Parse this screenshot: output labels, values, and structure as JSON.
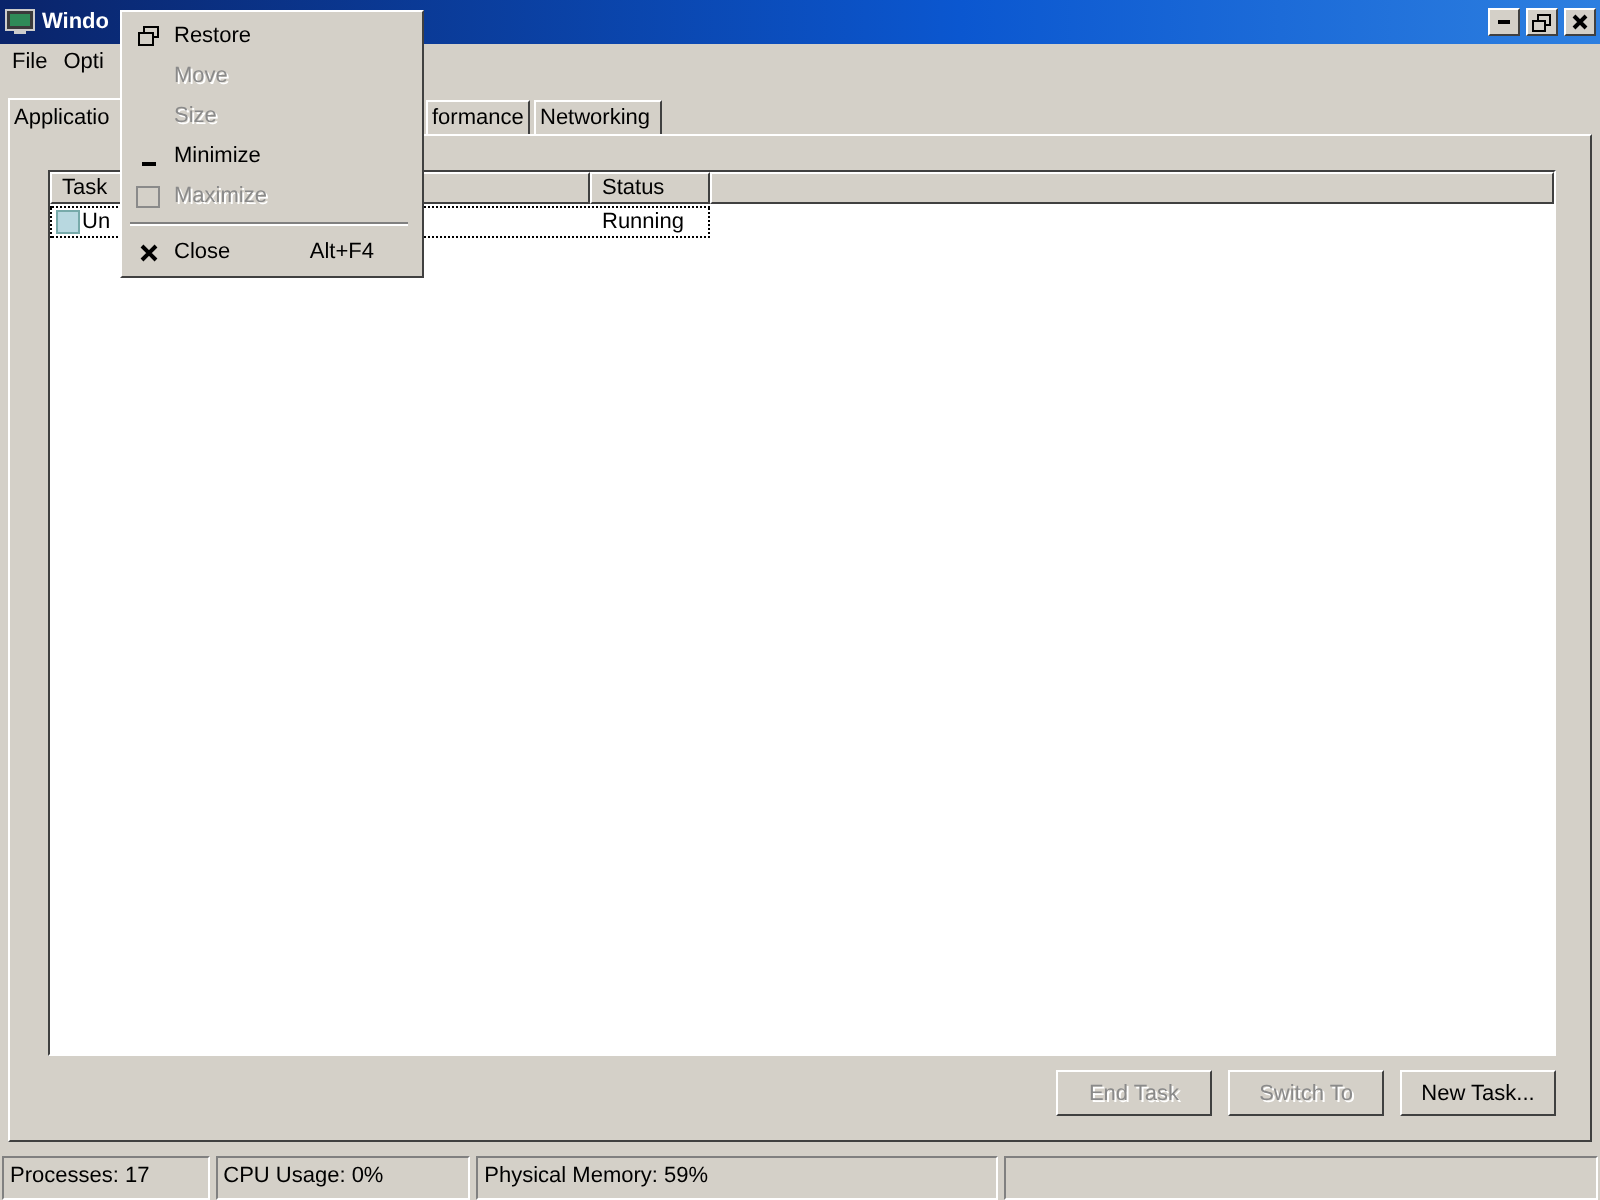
{
  "window": {
    "title": "Windo"
  },
  "menubar": [
    "File",
    "Opti"
  ],
  "tabs": [
    {
      "label": "Applicatio",
      "selected": true
    },
    {
      "label": "formance",
      "selected": false
    },
    {
      "label": "Networking",
      "selected": false
    }
  ],
  "table": {
    "columns": [
      "Task",
      "Status"
    ],
    "rows": [
      {
        "task": "Un",
        "status": "Running",
        "selected": true
      }
    ]
  },
  "buttons": [
    {
      "label": "End Task",
      "disabled": true
    },
    {
      "label": "Switch To",
      "disabled": true
    },
    {
      "label": "New Task...",
      "disabled": false
    }
  ],
  "status_bar": [
    "Processes: 17",
    "CPU Usage: 0%",
    "Physical Memory: 59%"
  ],
  "system_menu": [
    {
      "kind": "restore",
      "label": "Restore",
      "disabled": false
    },
    {
      "kind": "plain",
      "label": "Move",
      "disabled": true
    },
    {
      "kind": "plain",
      "label": "Size",
      "disabled": true
    },
    {
      "kind": "minimize",
      "label": "Minimize",
      "disabled": false
    },
    {
      "kind": "maximize",
      "label": "Maximize",
      "disabled": true
    },
    {
      "kind": "separator"
    },
    {
      "kind": "close",
      "label": "Close",
      "shortcut": "Alt+F4",
      "disabled": false
    }
  ]
}
